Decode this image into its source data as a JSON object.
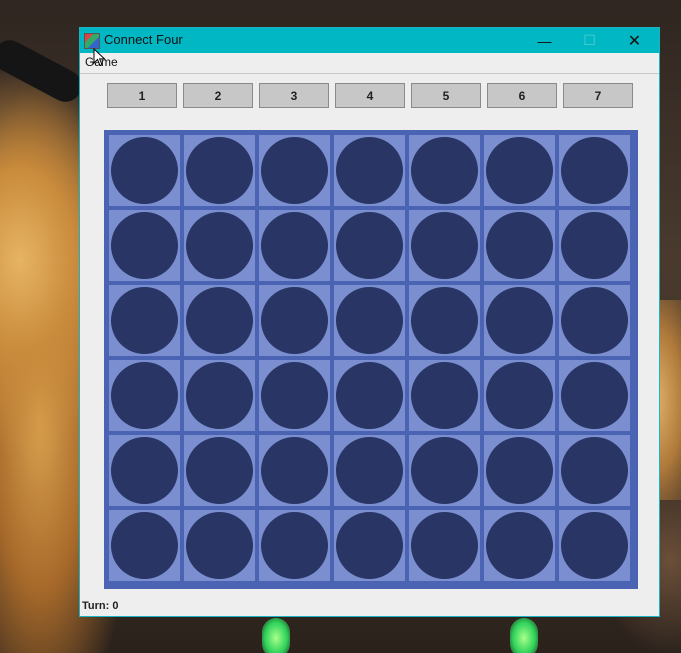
{
  "window": {
    "title": "Connect Four",
    "controls": {
      "minimize": "—",
      "maximize": "☐",
      "close": "✕"
    }
  },
  "menu": {
    "items": [
      "Game"
    ]
  },
  "columns": [
    "1",
    "2",
    "3",
    "4",
    "5",
    "6",
    "7"
  ],
  "board": {
    "rows": 6,
    "cols": 7,
    "empty_color": "#283565",
    "frame_color": "#4a63b3",
    "cell_color": "#7b8fd0"
  },
  "status": {
    "turn_text": "Turn: 0"
  },
  "colors": {
    "titlebar": "#00b7c3",
    "window_bg": "#eeeeee",
    "button_bg": "#c7c7c7"
  }
}
